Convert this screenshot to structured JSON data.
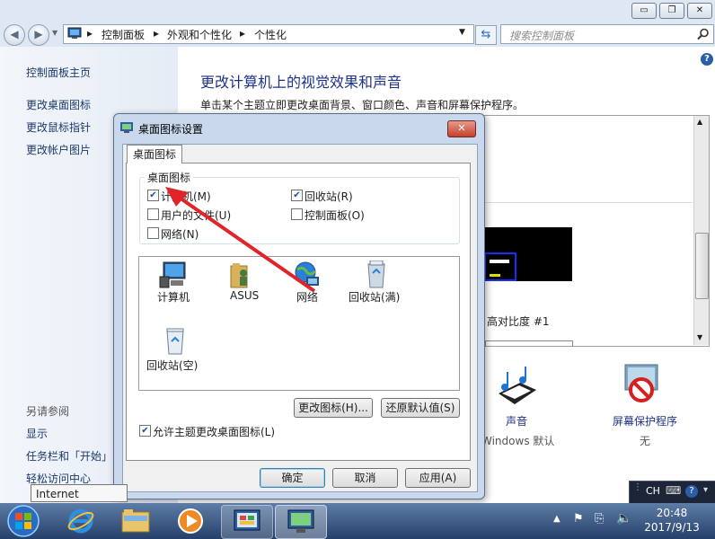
{
  "window": {
    "controls": {
      "minimize": "▭",
      "maximize": "❐",
      "close": "✕"
    }
  },
  "address": {
    "breadcrumbs": [
      "控制面板",
      "外观和个性化",
      "个性化"
    ],
    "search_placeholder": "搜索控制面板"
  },
  "leftnav": {
    "items": [
      "控制面板主页",
      "更改桌面图标",
      "更改鼠标指针",
      "更改帐户图片"
    ],
    "see_also_title": "另请参阅",
    "see_also": [
      "显示",
      "任务栏和「开始」",
      "轻松访问中心"
    ]
  },
  "main": {
    "title": "更改计算机上的视觉效果和声音",
    "description": "单击某个主题立即更改桌面背景、窗口颜色、声音和屏幕保护程序。",
    "theme_label": "高对比度 #1",
    "sound": {
      "label": "声音",
      "value": "Windows 默认"
    },
    "screensaver": {
      "label": "屏幕保护程序",
      "value": "无"
    }
  },
  "dialog": {
    "title": "桌面图标设置",
    "tab": "桌面图标",
    "group_title": "桌面图标",
    "checkboxes": [
      {
        "label": "计算机(M)",
        "checked": true
      },
      {
        "label": "回收站(R)",
        "checked": true
      },
      {
        "label": "用户的文件(U)",
        "checked": false
      },
      {
        "label": "控制面板(O)",
        "checked": false
      },
      {
        "label": "网络(N)",
        "checked": false
      }
    ],
    "icons": [
      "计算机",
      "ASUS",
      "网络",
      "回收站(满)",
      "回收站(空)"
    ],
    "change_icon_button": "更改图标(H)...",
    "restore_default_button": "还原默认值(S)",
    "allow_theme_checkbox": {
      "label": "允许主题更改桌面图标(L)",
      "checked": true
    },
    "ok_button": "确定",
    "cancel_button": "取消",
    "apply_button": "应用(A)"
  },
  "tooltip": "Internet Explorer",
  "taskbar": {
    "lang": "CH",
    "time": "20:48",
    "date": "2017/9/13"
  }
}
